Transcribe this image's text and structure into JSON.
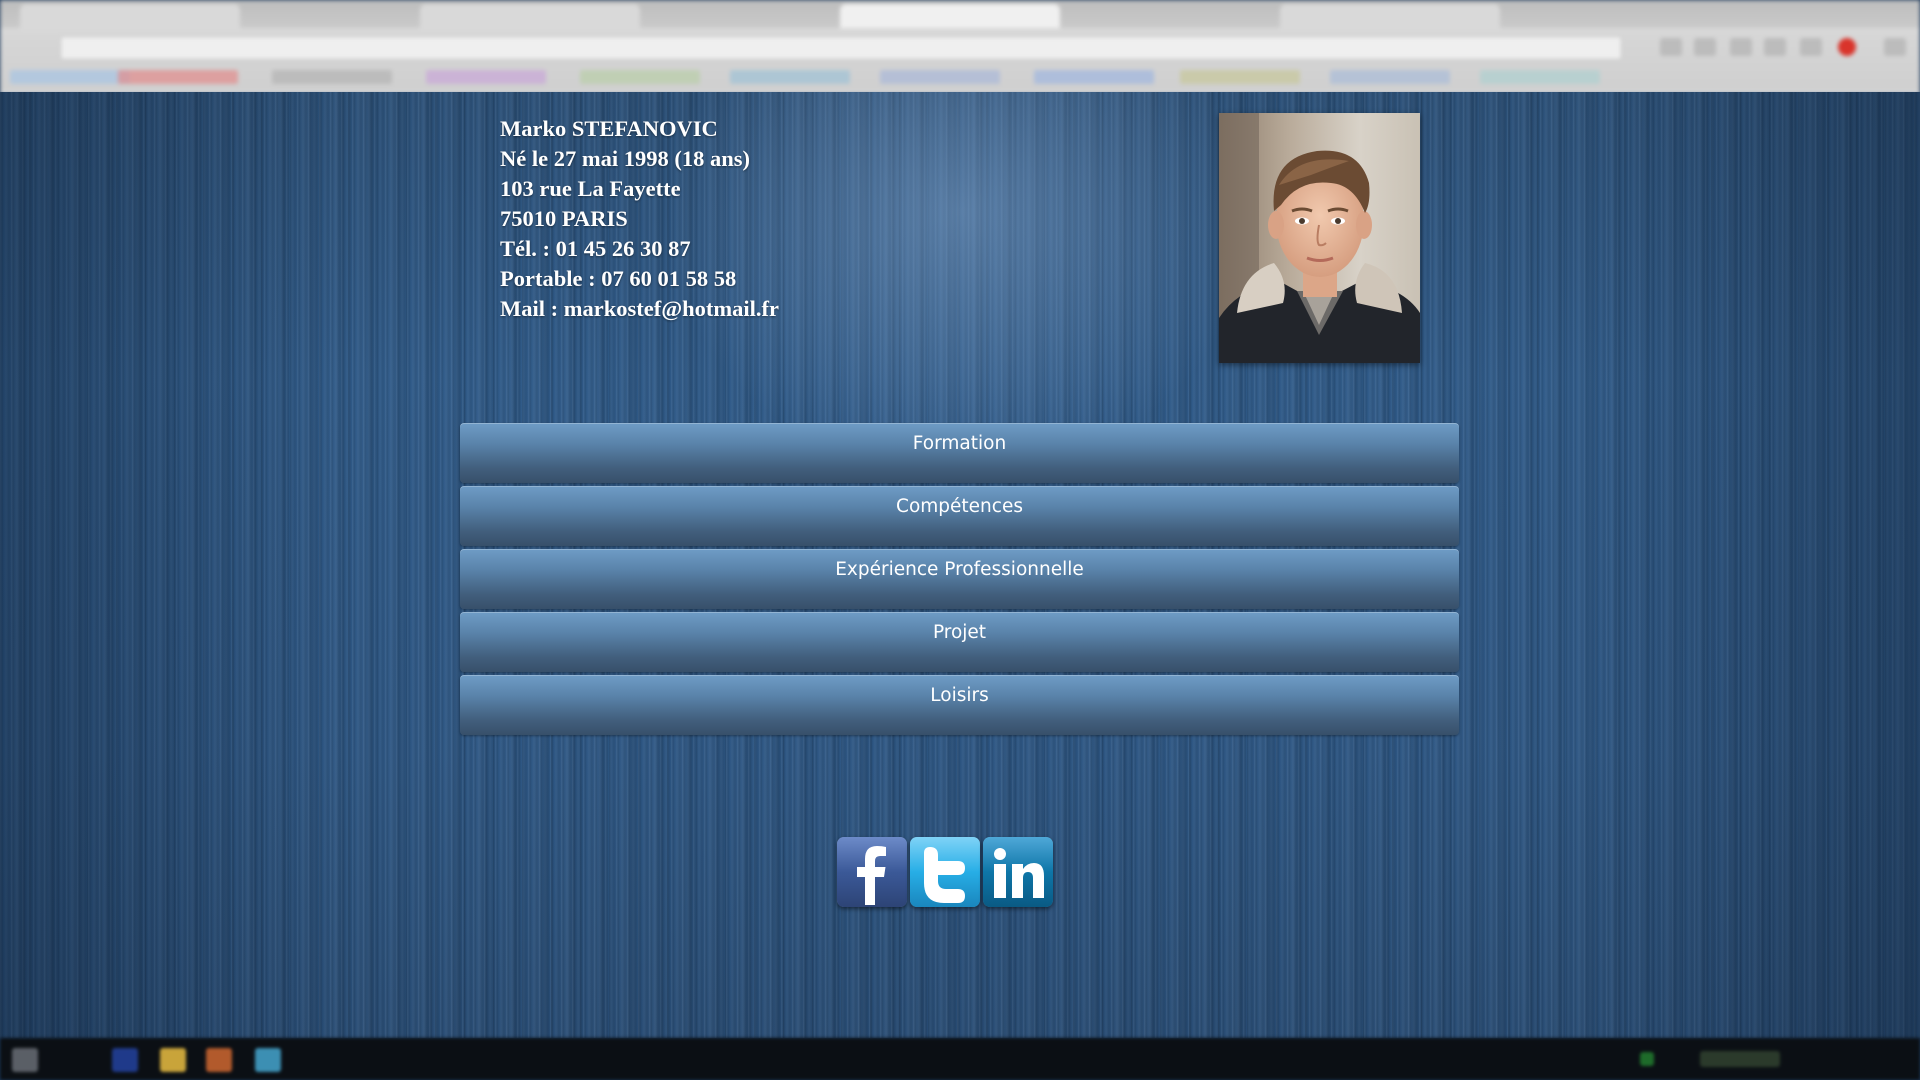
{
  "identity": {
    "name": "Marko STEFANOVIC",
    "birth": "Né le 27 mai 1998 (18 ans)",
    "street": "103 rue La Fayette",
    "city": "75010 PARIS",
    "phone": "Tél. : 01 45 26 30 87",
    "mobile": "Portable : 07 60 01 58 58",
    "mail": "Mail : markostef@hotmail.fr"
  },
  "menu": {
    "items": [
      {
        "label": "Formation"
      },
      {
        "label": "Compétences"
      },
      {
        "label": "Expérience Professionnelle"
      },
      {
        "label": "Projet"
      },
      {
        "label": "Loisirs"
      }
    ]
  },
  "social": {
    "icons": [
      {
        "icon": "facebook-icon",
        "color": "#3b5998"
      },
      {
        "icon": "twitter-icon",
        "color": "#1da1f2"
      },
      {
        "icon": "linkedin-icon",
        "color": "#0e76a8"
      }
    ]
  },
  "colors": {
    "background": "#2e5682",
    "button_top": "#6f9cc6",
    "button_bottom": "#37506a",
    "text": "#ffffff"
  }
}
